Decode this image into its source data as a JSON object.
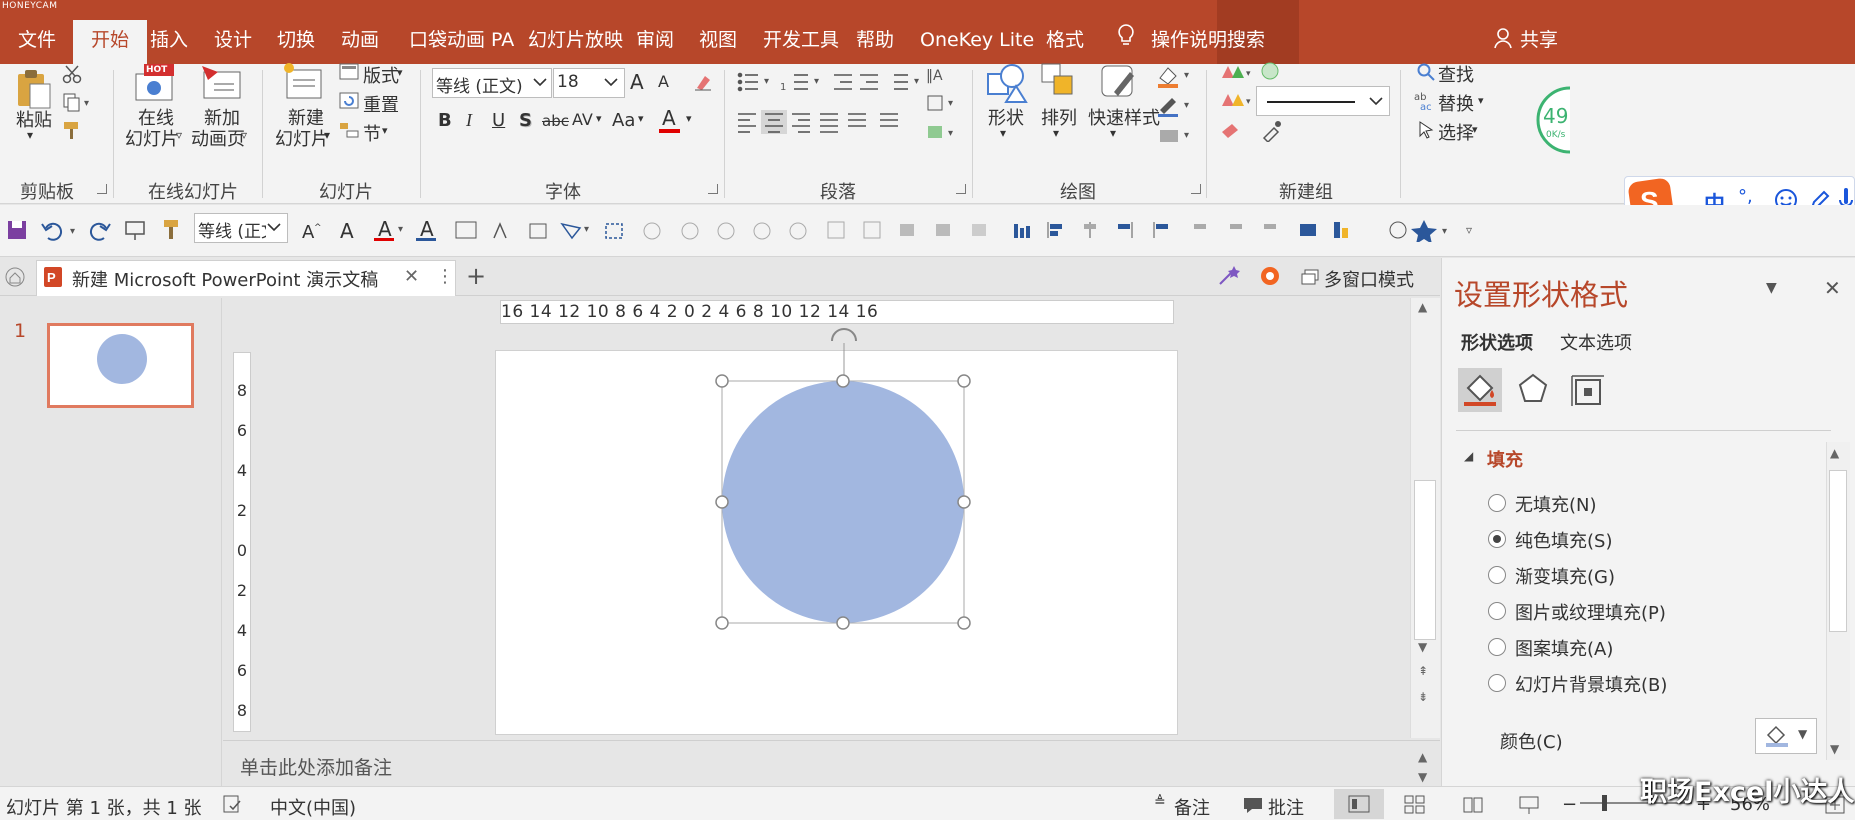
{
  "watermark_app": "HONEYCAM",
  "tabs": [
    "文件",
    "开始",
    "插入",
    "设计",
    "切换",
    "动画",
    "口袋动画 PA",
    "幻灯片放映",
    "审阅",
    "视图",
    "开发工具",
    "帮助",
    "OneKey Lite",
    "格式"
  ],
  "tell_me": "操作说明搜索",
  "share": "共享",
  "ribbon": {
    "clipboard": {
      "paste": "粘贴",
      "label": "剪贴板"
    },
    "online": {
      "b1a": "在线",
      "b1b": "幻灯片",
      "b2a": "新加",
      "b2b": "动画页",
      "hot": "HOT",
      "label": "在线幻灯片"
    },
    "slides": {
      "new_a": "新建",
      "new_b": "幻灯片",
      "layout": "版式",
      "reset": "重置",
      "section": "节",
      "label": "幻灯片"
    },
    "font": {
      "name": "等线 (正文)",
      "size": "18",
      "label": "字体",
      "b": "B",
      "i": "I",
      "u": "U",
      "s": "S",
      "abc": "abc",
      "av": "AV",
      "aa": "Aa",
      "grow": "A",
      "shrink": "A",
      "color_a": "A"
    },
    "paragraph": {
      "label": "段落"
    },
    "drawing": {
      "shapes": "形状",
      "arrange": "排列",
      "quick": "快速样式",
      "label": "绘图"
    },
    "newgroup": {
      "label": "新建组"
    },
    "editing": {
      "find": "查找",
      "replace": "替换",
      "select": "选择"
    },
    "zoom_badge_top": "49",
    "zoom_badge_sub": "0K/s"
  },
  "qat": {
    "font_name": "等线 (正文"
  },
  "doc_tab": {
    "title": "新建 Microsoft  PowerPoint 演示文稿",
    "close": "✕",
    "more": "⋮",
    "add": "+"
  },
  "multi_window": "多窗口模式",
  "slide_number": "1",
  "hruler_text": "16 14 12 10 8 6 4 2 0 2 4 6 8 10 12 14 16",
  "vruler_ticks": [
    "8",
    "6",
    "4",
    "2",
    "0",
    "2",
    "4",
    "6",
    "8"
  ],
  "notes_placeholder": "单击此处添加备注",
  "pane": {
    "title": "设置形状格式",
    "tab_shape": "形状选项",
    "tab_text": "文本选项",
    "section": "填充",
    "options": [
      "无填充(N)",
      "纯色填充(S)",
      "渐变填充(G)",
      "图片或纹理填充(P)",
      "图案填充(A)",
      "幻灯片背景填充(B)"
    ],
    "selected_index": 1,
    "color_label": "颜色(C)"
  },
  "status": {
    "slide_info": "幻灯片 第 1 张，共 1 张",
    "language": "中文(中国)",
    "notes": "备注",
    "comments": "批注",
    "zoom": "56%"
  },
  "ime": {
    "zh": "中",
    "punct": "°,"
  },
  "watermark": "职场Excel小达人",
  "colors": {
    "accent": "#b7472a",
    "shape_fill": "#a2b7e0",
    "pane_title": "#b7472a"
  }
}
